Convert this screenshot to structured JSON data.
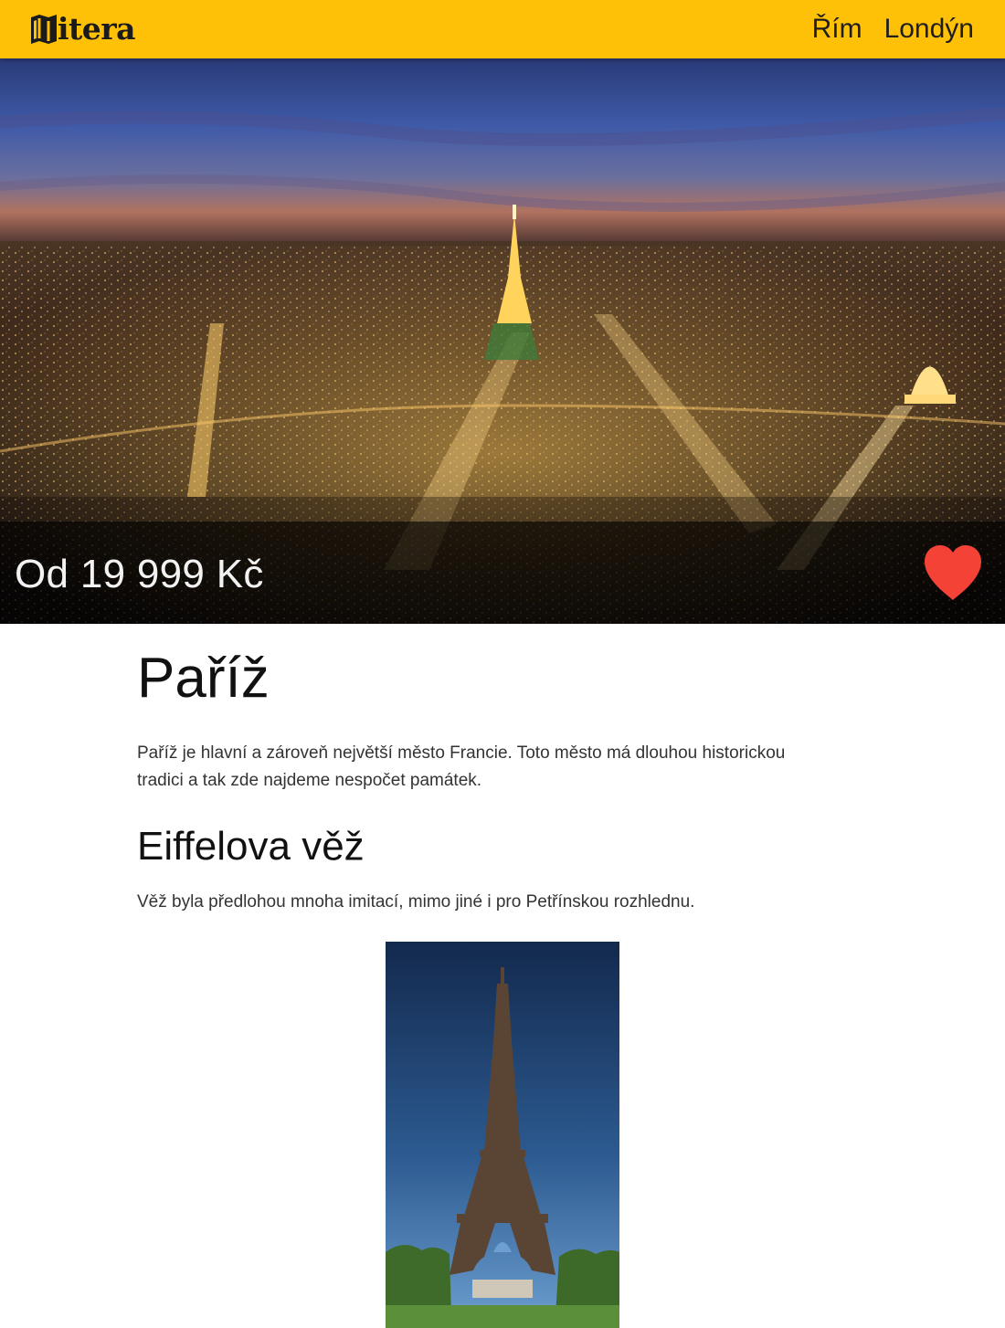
{
  "header": {
    "logo_text": "itera",
    "logo_icon": "map-icon",
    "nav": [
      {
        "label": "Řím"
      },
      {
        "label": "Londýn"
      }
    ],
    "accent_color": "#ffc107"
  },
  "hero": {
    "image": "paris-night-skyline-photo",
    "price_label": "Od 19 999 Kč",
    "favorite_icon": "heart-icon",
    "favorite_color": "#f44336"
  },
  "main": {
    "title": "Paříž",
    "intro": "Paříž je hlavní a zároveň největší město Francie. Toto město má dlouhou historickou tradici a tak zde najdeme nespočet památek.",
    "section": {
      "title": "Eiffelova věž",
      "text": "Věž byla předlohou mnoha imitací, mimo jiné i pro Petřínskou rozhlednu.",
      "image": "eiffel-tower-photo"
    }
  }
}
